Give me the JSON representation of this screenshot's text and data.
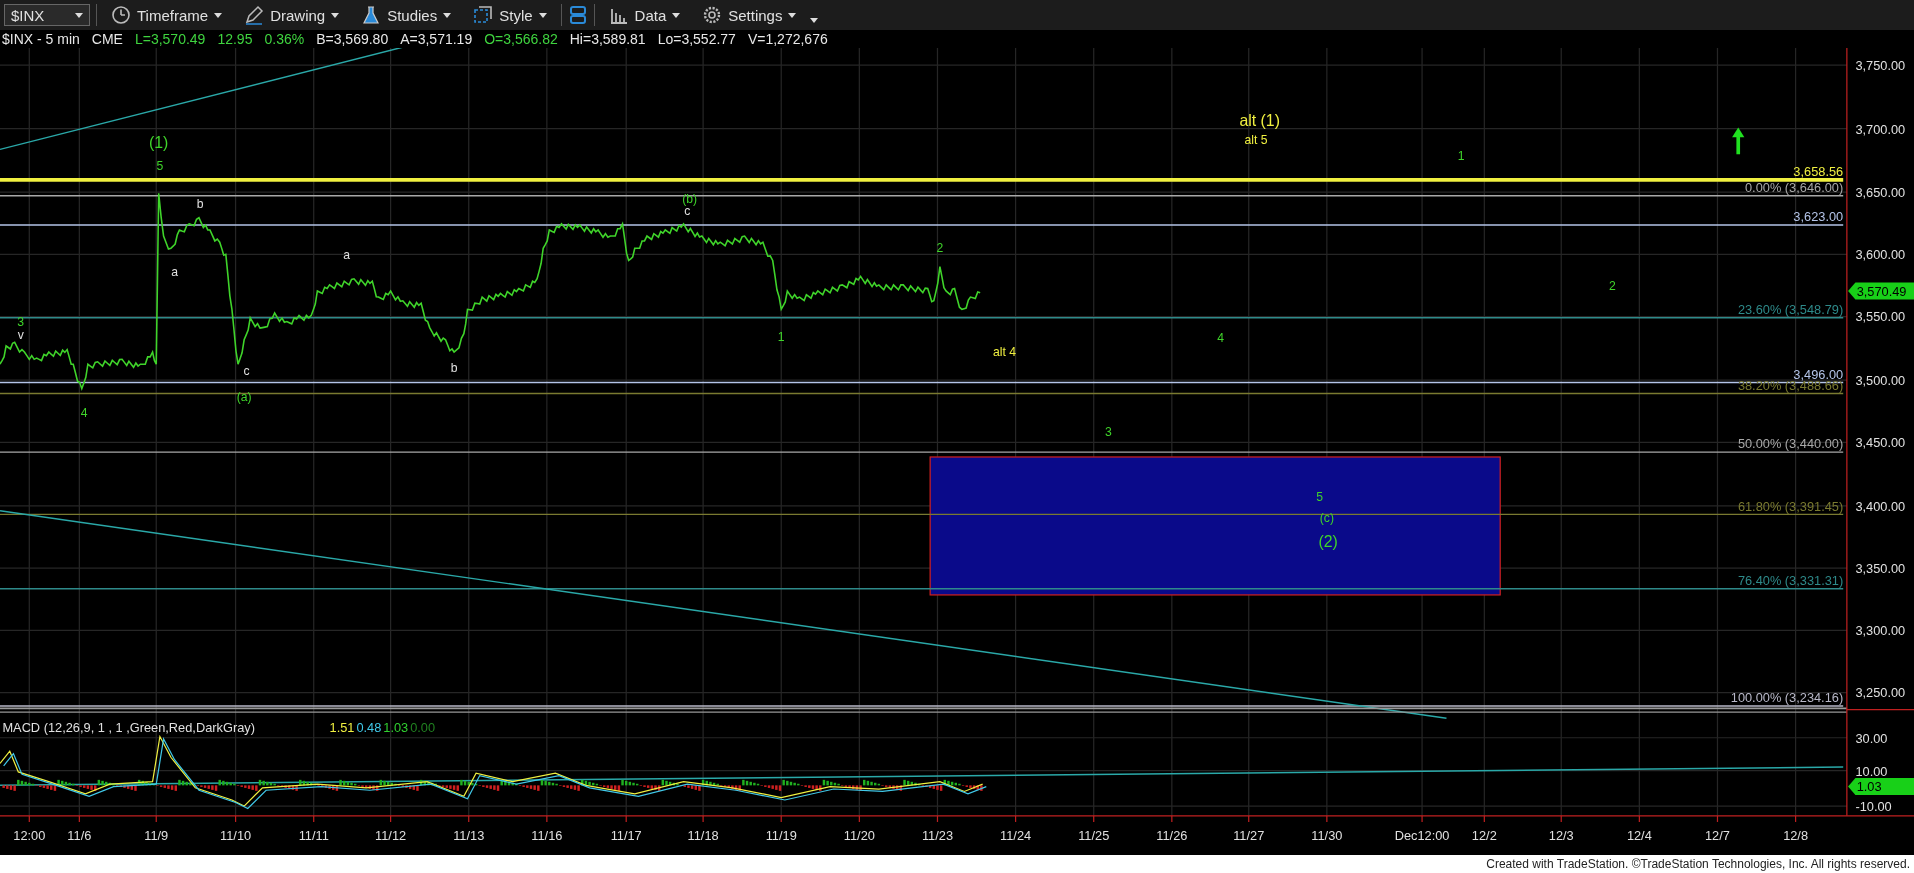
{
  "toolbar": {
    "symbol": "$INX",
    "menus": [
      {
        "label": "Timeframe"
      },
      {
        "label": "Drawing"
      },
      {
        "label": "Studies"
      },
      {
        "label": "Style"
      },
      {
        "label": "Data"
      },
      {
        "label": "Settings"
      }
    ]
  },
  "quote_line": {
    "symbol": "$INX - 5 min",
    "exchange": "CME",
    "last": "L=3,570.49",
    "change": "12.95",
    "change_pct": "0.36%",
    "bid": "B=3,569.80",
    "ask": "A=3,571.19",
    "open": "O=3,566.82",
    "high": "Hi=3,589.81",
    "low": "Lo=3,552.77",
    "volume": "V=1,272,676"
  },
  "price_axis": {
    "labels": [
      "3,750.00",
      "3,700.00",
      "3,650.00",
      "3,600.00",
      "3,550.00",
      "3,500.00",
      "3,450.00",
      "3,400.00",
      "3,350.00",
      "3,300.00",
      "3,250.00"
    ],
    "last_price": "3,570.49"
  },
  "levels": [
    {
      "label": "3,658.56",
      "color": "#f0f040"
    },
    {
      "label": "0.00% (3,646.00)",
      "color": "#a8a8a8"
    },
    {
      "label": "3,623.00",
      "color": "#b4c4e8"
    },
    {
      "label": "23.60% (3,548.79)",
      "color": "#2e8a8a"
    },
    {
      "label": "3,496.00",
      "color": "#b4c4e8"
    },
    {
      "label": "38.20% (3,488.66)",
      "color": "#7a7a30"
    },
    {
      "label": "50.00% (3,440.00)",
      "color": "#a8a8a8"
    },
    {
      "label": "61.80% (3,391.45)",
      "color": "#7a7a30"
    },
    {
      "label": "76.40% (3,331.31)",
      "color": "#2e8a8a"
    },
    {
      "label": "100.00% (3,234.16)",
      "color": "#b8b8c8"
    }
  ],
  "wave_labels": [
    {
      "text": "(1)",
      "color": "#3fd42a"
    },
    {
      "text": "5",
      "color": "#3fd42a"
    },
    {
      "text": "b",
      "color": "#e0e0e0"
    },
    {
      "text": "a",
      "color": "#e0e0e0"
    },
    {
      "text": "c",
      "color": "#e0e0e0"
    },
    {
      "text": "(a)",
      "color": "#3fd42a"
    },
    {
      "text": "3",
      "color": "#3fd42a"
    },
    {
      "text": "v",
      "color": "#e0e0e0"
    },
    {
      "text": "4",
      "color": "#3fd42a"
    },
    {
      "text": "a",
      "color": "#e0e0e0"
    },
    {
      "text": "b",
      "color": "#e0e0e0"
    },
    {
      "text": "(b)",
      "color": "#3fd42a"
    },
    {
      "text": "c",
      "color": "#e0e0e0"
    },
    {
      "text": "1",
      "color": "#3fd42a"
    },
    {
      "text": "2",
      "color": "#3fd42a"
    },
    {
      "text": "alt (1)",
      "color": "#f0f040"
    },
    {
      "text": "alt 5",
      "color": "#f0f040"
    },
    {
      "text": "alt 4",
      "color": "#f0f040"
    },
    {
      "text": "1",
      "color": "#3fd42a"
    },
    {
      "text": "2",
      "color": "#3fd42a"
    },
    {
      "text": "4",
      "color": "#3fd42a"
    },
    {
      "text": "3",
      "color": "#3fd42a"
    },
    {
      "text": "5",
      "color": "#3fd42a"
    },
    {
      "text": "(c)",
      "color": "#3fd42a"
    },
    {
      "text": "(2)",
      "color": "#3fd42a"
    }
  ],
  "macd": {
    "title": "MACD (12,26,9, 1 , 1 ,Green,Red,DarkGray)",
    "values": [
      {
        "text": "1.51",
        "color": "#f0f040"
      },
      {
        "text": "0.48",
        "color": "#40c8e8"
      },
      {
        "text": "1.03",
        "color": "#30d030"
      },
      {
        "text": "0.00",
        "color": "#208020"
      }
    ],
    "axis_labels": [
      "30.00",
      "10.00",
      "-10.00"
    ],
    "last_value": "1.03"
  },
  "time_axis": {
    "labels": [
      "12:00",
      "11/6",
      "11/9",
      "11/10",
      "11/11",
      "11/12",
      "11/13",
      "11/16",
      "11/17",
      "11/18",
      "11/19",
      "11/20",
      "11/23",
      "11/24",
      "11/25",
      "11/26",
      "11/27",
      "11/30",
      "Dec12:00",
      "12/2",
      "12/3",
      "12/4",
      "12/7",
      "12/8"
    ]
  },
  "footer": "Created with TradeStation. ©TradeStation Technologies, Inc. All rights reserved."
}
